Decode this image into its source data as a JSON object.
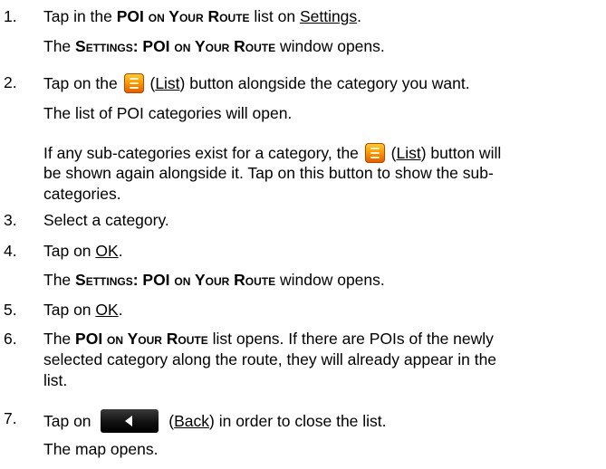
{
  "steps": [
    {
      "num": "1.",
      "parts": [
        "Tap in the ",
        "POI on Your Route",
        " list on ",
        "Settings",
        "."
      ],
      "result_parts": [
        "The ",
        "Settings: POI on Your Route",
        " window opens."
      ]
    },
    {
      "num": "2.",
      "parts": [
        "Tap on the ",
        " (",
        "List",
        ") button alongside the category you want."
      ],
      "result": "The list of POI categories will open.",
      "note_parts": [
        "If any sub-categories exist for a category, the ",
        " (",
        "List",
        ") button will",
        "be shown again alongside it. Tap on this button to show the sub-",
        "categories."
      ]
    },
    {
      "num": "3.",
      "text": "Select a category."
    },
    {
      "num": "4.",
      "parts": [
        "Tap on ",
        "OK",
        "."
      ],
      "result_parts": [
        "The ",
        "Settings: POI on Your Route",
        " window opens."
      ]
    },
    {
      "num": "5.",
      "parts": [
        "Tap on ",
        "OK",
        "."
      ]
    },
    {
      "num": "6.",
      "lines": [
        [
          "The ",
          "POI on Your Route",
          " list opens. If there are POIs of the newly"
        ],
        "selected category along the route, they will already appear in the",
        "list."
      ]
    },
    {
      "num": "7.",
      "parts": [
        "Tap on ",
        " (",
        "Back",
        ") in order to close the list."
      ],
      "result": "The map opens."
    }
  ],
  "icons": {
    "list_button": "list-icon",
    "back_button": "back-arrow-icon"
  }
}
